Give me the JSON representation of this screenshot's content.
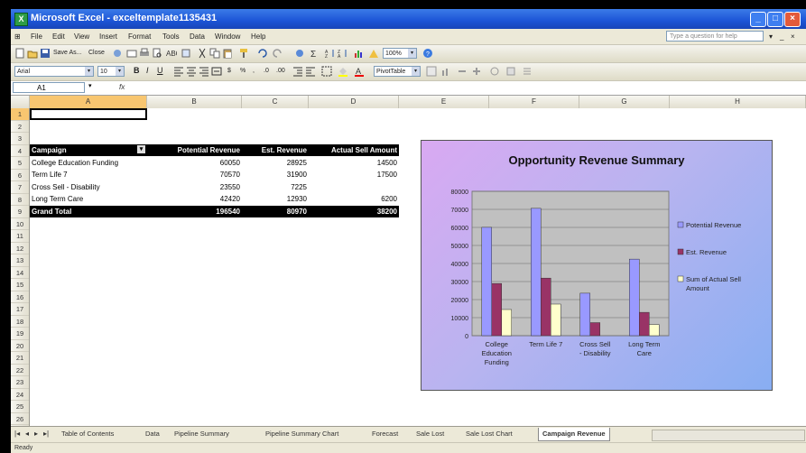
{
  "window": {
    "title": "Microsoft Excel - exceltemplate1135431",
    "icon": "excel-icon"
  },
  "menu": {
    "items": [
      "File",
      "Edit",
      "View",
      "Insert",
      "Format",
      "Tools",
      "Data",
      "Window",
      "Help"
    ],
    "help_placeholder": "Type a question for help"
  },
  "toolbar": {
    "save_label": "Save As...",
    "close_label": "Close",
    "zoom": "100%",
    "font": "Arial",
    "font_size": "10",
    "pivot_label": "PivotTable",
    "accent_color": "#1c54d6"
  },
  "formula_bar": {
    "cell": "A1",
    "fx": "fx",
    "value": ""
  },
  "columns": [
    "A",
    "B",
    "C",
    "D",
    "E",
    "F",
    "G",
    "H"
  ],
  "rows": [
    "1",
    "2",
    "3",
    "4",
    "5",
    "6",
    "7",
    "8",
    "9",
    "10",
    "11",
    "12",
    "13",
    "14",
    "15",
    "16",
    "17",
    "18",
    "19",
    "20",
    "21",
    "22",
    "23",
    "24",
    "25",
    "26"
  ],
  "table": {
    "headers": [
      "Campaign",
      "Potential Revenue",
      "Est. Revenue",
      "Actual Sell Amount"
    ],
    "rows": [
      [
        "College Education Funding",
        "60050",
        "28925",
        "14500"
      ],
      [
        "Term Life 7",
        "70570",
        "31900",
        "17500"
      ],
      [
        "Cross Sell - Disability",
        "23550",
        "7225",
        ""
      ],
      [
        "Long Term Care",
        "42420",
        "12930",
        "6200"
      ]
    ],
    "total": [
      "Grand Total",
      "196540",
      "80970",
      "38200"
    ]
  },
  "chart_data": {
    "type": "bar",
    "title": "Opportunity Revenue Summary",
    "categories": [
      "College Education Funding",
      "Term Life 7",
      "Cross Sell - Disability",
      "Long Term Care"
    ],
    "category_lines": [
      [
        "College",
        "Education",
        "Funding"
      ],
      [
        "Term Life 7"
      ],
      [
        "Cross Sell",
        "- Disability"
      ],
      [
        "Long Term",
        "Care"
      ]
    ],
    "series": [
      {
        "name": "Potential Revenue",
        "values": [
          60050,
          70570,
          23550,
          42420
        ],
        "color": "#9999ff"
      },
      {
        "name": "Est. Revenue",
        "values": [
          28925,
          31900,
          7225,
          12930
        ],
        "color": "#993366"
      },
      {
        "name": "Sum of Actual Sell Amount",
        "values": [
          14500,
          17500,
          0,
          6200
        ],
        "color": "#ffffcc"
      }
    ],
    "legend_lines": [
      [
        "Potential Revenue"
      ],
      [
        "Est. Revenue"
      ],
      [
        "Sum of Actual Sell",
        "Amount"
      ]
    ],
    "ylim": [
      0,
      80000
    ],
    "yticks": [
      "0",
      "10000",
      "20000",
      "30000",
      "40000",
      "50000",
      "60000",
      "70000",
      "80000"
    ],
    "plot_bg": "#c0c0c0",
    "grid": true,
    "legend": "right"
  },
  "tabs": [
    "Table of Contents",
    "Data",
    "Pipeline Summary",
    "Pipeline Summary Chart",
    "Forecast",
    "Sale Lost",
    "Sale Lost Chart",
    "Campaign Revenue"
  ],
  "active_tab": "Campaign Revenue",
  "status": "Ready"
}
